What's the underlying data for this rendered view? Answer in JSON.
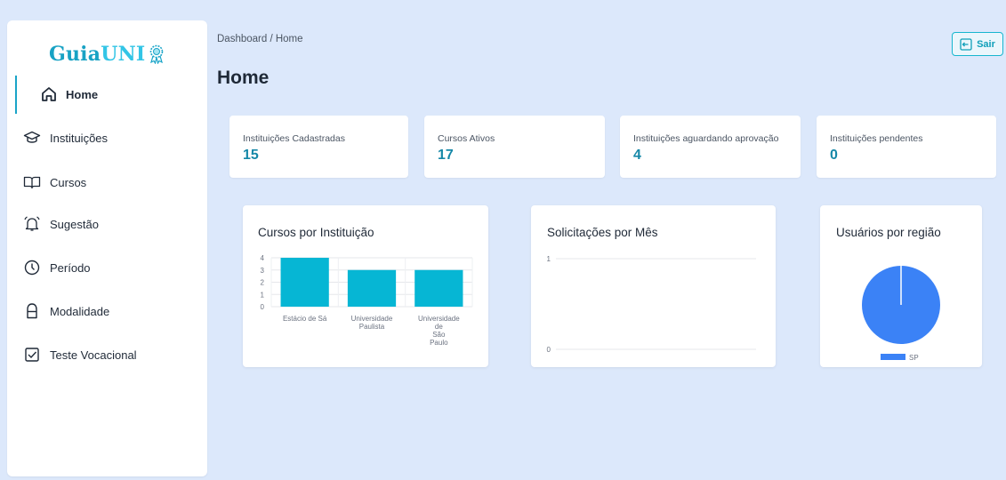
{
  "sidebar": {
    "logo": {
      "bold": "Guia",
      "light": "UNI"
    },
    "items": [
      {
        "label": "Home",
        "icon": "home-icon"
      },
      {
        "label": "Instituições",
        "icon": "graduation-cap-icon"
      },
      {
        "label": "Cursos",
        "icon": "book-icon"
      },
      {
        "label": "Sugestão",
        "icon": "bell-icon"
      },
      {
        "label": "Período",
        "icon": "clock-icon"
      },
      {
        "label": "Modalidade",
        "icon": "bag-icon"
      },
      {
        "label": "Teste Vocacional",
        "icon": "checkbox-icon"
      }
    ]
  },
  "header": {
    "breadcrumb": "Dashboard / Home",
    "title": "Home",
    "logout_label": "Sair"
  },
  "stats": [
    {
      "label": "Instituições Cadastradas",
      "value": "15"
    },
    {
      "label": "Cursos Ativos",
      "value": "17"
    },
    {
      "label": "Instituições aguardando aprovação",
      "value": "4"
    },
    {
      "label": "Instituições pendentes",
      "value": "0"
    }
  ],
  "colors": {
    "accent": "#1aa4c8",
    "bar": "#06b6d4",
    "pie": "#3b82f6"
  },
  "chart_data": [
    {
      "type": "bar",
      "title": "Cursos por Instituição",
      "categories": [
        "Estácio de Sá",
        "Universidade Paulista",
        "Universidade de São Paulo"
      ],
      "values": [
        4,
        3,
        3
      ],
      "yticks": [
        "4",
        "3",
        "2",
        "1",
        "0"
      ],
      "ylim": [
        0,
        4
      ],
      "grid": true
    },
    {
      "type": "line",
      "title": "Solicitações por Mês",
      "series": [],
      "yticks": [
        "1",
        "0"
      ],
      "ylim": [
        0,
        1
      ]
    },
    {
      "type": "pie",
      "title": "Usuários por região",
      "labels": [
        "SP"
      ],
      "values": [
        1
      ],
      "legend": "bottom"
    }
  ]
}
